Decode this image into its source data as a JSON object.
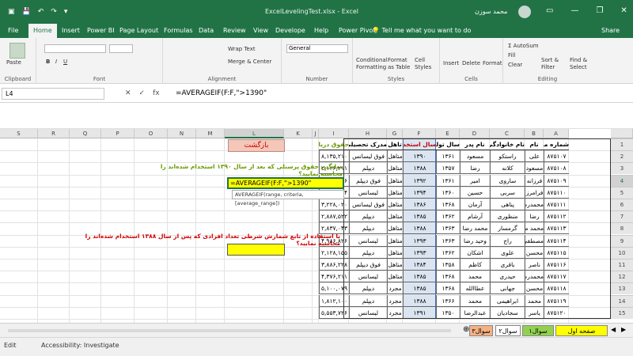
{
  "window": {
    "title": "ExcelLevelingTest.xlsx  -  Excel",
    "user": "محمد سوزن",
    "minimize": "—",
    "restore": "❐",
    "close": "✕"
  },
  "tabs": [
    "File",
    "Home",
    "Insert",
    "Power BI",
    "Page Layout",
    "Formulas",
    "Data",
    "Review",
    "View",
    "Develope",
    "Help",
    "Power Pivot"
  ],
  "active_tab": "Home",
  "tellme": "Tell me what you want to do",
  "share": "Share",
  "ribbon": {
    "clipboard": {
      "label": "Clipboard",
      "paste": "Paste"
    },
    "font": {
      "label": "Font",
      "bold": "B",
      "italic": "I",
      "underline": "U"
    },
    "alignment": {
      "label": "Alignment",
      "wrap": "Wrap Text",
      "merge": "Merge & Center"
    },
    "number": {
      "label": "Number",
      "format": "General"
    },
    "styles": {
      "label": "Styles",
      "cond": "Conditional Formatting",
      "table": "Format as Table",
      "cell": "Cell Styles"
    },
    "cells": {
      "label": "Cells",
      "insert": "Insert",
      "delete": "Delete",
      "format": "Format"
    },
    "editing": {
      "label": "Editing",
      "autosum": "AutoSum",
      "fill": "Fill",
      "clear": "Clear",
      "sort": "Sort & Filter",
      "find": "Find & Select"
    }
  },
  "namebox": "L4",
  "formula": "=AVERAGEIF(F:F,\">1390\"",
  "columns": [
    "S",
    "R",
    "Q",
    "P",
    "O",
    "N",
    "M",
    "L",
    "K",
    "J",
    "I",
    "H",
    "G",
    "F",
    "E",
    "D",
    "C",
    "B",
    "A"
  ],
  "selected_column": "L",
  "rows": [
    "1",
    "2",
    "3",
    "4",
    "5",
    "6",
    "7",
    "8",
    "9",
    "10",
    "11",
    "12",
    "13",
    "14",
    "15"
  ],
  "selected_row": "4",
  "table": {
    "headers": [
      "شماره ملی",
      "نام",
      "نام خانوادگی",
      "نام پدر",
      "سال تولد",
      "سال استخدام",
      "تاهل",
      "مدرک تحصیلی",
      "حقوق دریافتی"
    ],
    "rows": [
      [
        "۸۷۵۱۰۷",
        "علی",
        "راستکو",
        "مسعود",
        "۱۳۶۱",
        "۱۳۹۰",
        "متاهل",
        "فوق لیسانس",
        "۸,۱۳۵,۲۱۰"
      ],
      [
        "۸۷۵۱۰۸",
        "مسعود",
        "کلانه",
        "رضا",
        "۱۳۵۷",
        "۱۳۸۸",
        "متاهل",
        "دیپلم",
        "۲,۱۲۶,۲۱۱"
      ],
      [
        "۸۷۵۱۰۹",
        "فرزانه",
        "ساروی",
        "امیر",
        "۱۳۶۱",
        "۱۳۹۲",
        "متاهل",
        "فوق دیپلم",
        "۳,۳۵۳,۲۷۶"
      ],
      [
        "۸۷۵۱۱۰",
        "فرامرز",
        "سربی",
        "حسین",
        "۱۳۶۰",
        "۱۳۹۴",
        "متاهل",
        "لیسانس",
        "۵,۳۶۶,۳۳۴"
      ],
      [
        "۸۷۵۱۱۱",
        "محمدرضا",
        "پناهی",
        "آرمان",
        "۱۳۶۸",
        "۱۳۸۶",
        "متاهل",
        "فوق لیسانس",
        "۳,۲۲۸,۰۲۰"
      ],
      [
        "۸۷۵۱۱۲",
        "رضا",
        "منظوری",
        "آرشام",
        "۱۳۶۲",
        "۱۳۸۵",
        "متاهل",
        "دیپلم",
        "۲,۸۸۷,۵۲۲"
      ],
      [
        "۸۷۵۱۱۳",
        "محمد مهدی",
        "گرمسار",
        "محمد رضا",
        "۱۳۶۳",
        "۱۳۸۸",
        "متاهل",
        "دیپلم",
        "۲,۸۳۷,۰۴۳"
      ],
      [
        "۸۷۵۱۱۴",
        "مصطفی",
        "راج",
        "وحید رضا",
        "۱۳۶۳",
        "۱۳۹۳",
        "متاهل",
        "لیسانس",
        "۴,۹۸۶,۸۲۶"
      ],
      [
        "۸۷۵۱۱۵",
        "محسن",
        "علوی",
        "اشکان",
        "۱۳۶۲",
        "۱۳۹۳",
        "متاهل",
        "دیپلم",
        "۲,۱۲۸,۱۵۵"
      ],
      [
        "۸۷۵۱۱۶",
        "ناصر",
        "باقری",
        "کاظم",
        "۱۳۵۸",
        "۱۳۸۴",
        "متاهل",
        "فوق دیپلم",
        "۳,۸۸۶,۲۲۸"
      ],
      [
        "۸۷۵۱۱۷",
        "محمدرضا",
        "حیدری",
        "محمد",
        "۱۳۶۸",
        "۱۳۸۵",
        "متاهل",
        "لیسانس",
        "۴,۳۷۶,۲۱۱"
      ],
      [
        "۸۷۵۱۱۸",
        "محسن",
        "جهانی",
        "عطاالله",
        "۱۳۶۸",
        "۱۳۸۵",
        "مجرد",
        "دیپلم",
        "۵,۱۰۰,۰۷۹"
      ],
      [
        "۸۷۵۱۱۹",
        "محمد",
        "ابراهیمی",
        "محمد",
        "۱۳۶۶",
        "۱۳۸۸",
        "مجرد",
        "دیپلم",
        "۱,۸۱۲,۱۰۰"
      ],
      [
        "۸۷۵۱۲۰",
        "یاسر",
        "سجادیان",
        "عبدالرضا",
        "۱۳۵۰",
        "۱۳۹۱",
        "مجرد",
        "لیسانس",
        "۵,۵۵۳,۷۲۶"
      ]
    ]
  },
  "back_button": "بازگشت",
  "question1": "میانگین حقوق پرسنلی که بعد از سال ۱۳۹۰ استخدام شده‌اند را محاسبه نمایید؟",
  "question2": "با استفاده از تابع شمارش شرطی تعداد افرادی که پس از سال ۱۳۸۸ استخدام شده‌اند را محاسبه نمایید؟",
  "editing_cell": "=AVERAGEIF(F:F,\">1390\"",
  "tooltip": "AVERAGEIF(range, criteria, [average_range])",
  "sheet_tabs": [
    {
      "label": "صفحه اول",
      "color": "#ffff00"
    },
    {
      "label": "سوال۱",
      "color": "#92d050"
    },
    {
      "label": "سوال۲",
      "color": "#ffffff"
    },
    {
      "label": "سوال۳",
      "color": "#f4b183"
    }
  ],
  "status": {
    "mode": "Edit",
    "accessibility": "Accessibility: Investigate"
  }
}
